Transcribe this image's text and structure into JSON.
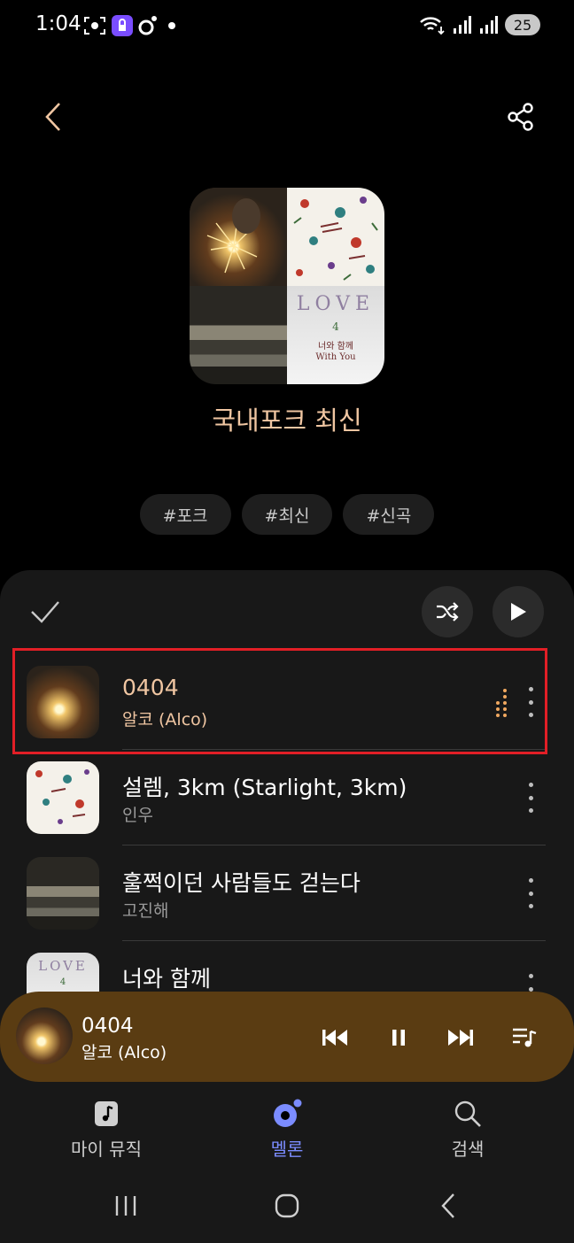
{
  "status_bar": {
    "time": "1:04",
    "battery": "25"
  },
  "header": {
    "back_icon": "chevron-left-icon",
    "share_icon": "share-icon"
  },
  "playlist": {
    "title": "국내포크 최신",
    "tags": [
      "#포크",
      "#최신",
      "#신곡"
    ],
    "cover_love_text": "LOVE",
    "cover_love_number": "4",
    "cover_love_subtitle_ko": "너와 함께",
    "cover_love_subtitle_en": "With You"
  },
  "controls": {
    "select_icon": "check-icon",
    "shuffle_icon": "shuffle-icon",
    "play_icon": "play-icon"
  },
  "tracks": [
    {
      "title": "0404",
      "artist": "알코 (Alco)",
      "now_playing": true
    },
    {
      "title": "설렘, 3km (Starlight, 3km)",
      "artist": "인우"
    },
    {
      "title": "훌쩍이던 사람들도 걷는다",
      "artist": "고진해"
    },
    {
      "title": "너와 함께",
      "artist": ""
    }
  ],
  "mini_player": {
    "title": "0404",
    "artist": "알코 (Alco)"
  },
  "bottom_nav": [
    {
      "label": "마이 뮤직",
      "icon": "music-note-icon"
    },
    {
      "label": "멜론",
      "icon": "melon-icon",
      "active": true
    },
    {
      "label": "검색",
      "icon": "search-icon"
    }
  ],
  "colors": {
    "accent": "#f0c6a2",
    "mini_player_bg": "#5a3c12",
    "nav_active": "#7b8cff",
    "highlight": "#e21f26"
  }
}
